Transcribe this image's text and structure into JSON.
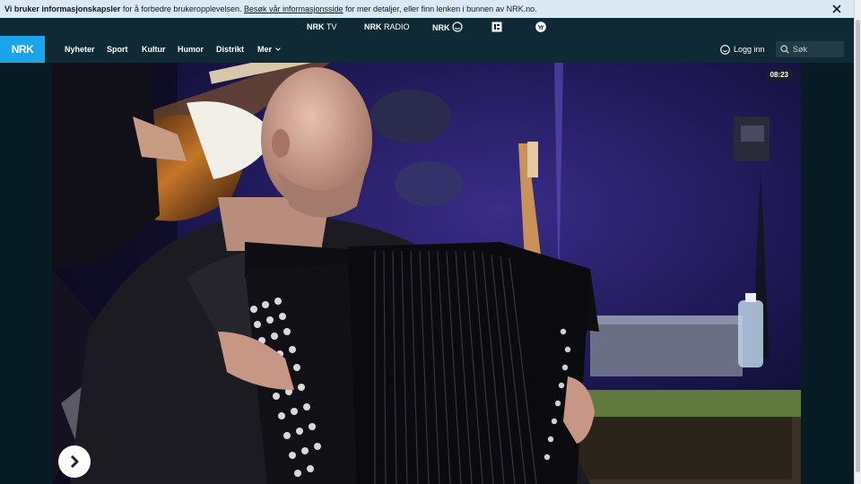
{
  "cookie_banner": {
    "bold_text": "Vi bruker informasjonskapsler",
    "text_after_bold": " for å forbedre brukeropplevelsen. ",
    "link_text": "Besøk vår informasjonsside",
    "text_after_link": " for mer detaljer, eller finn lenken i bunnen av NRK.no.",
    "close_icon": "close-icon"
  },
  "services": {
    "tv_logo": "NRK",
    "tv_label": "TV",
    "radio_logo": "NRK",
    "radio_label": "RADIO",
    "super_logo": "NRK"
  },
  "nav": {
    "logo": "NRK",
    "items": [
      {
        "label": "Nyheter"
      },
      {
        "label": "Sport"
      },
      {
        "label": "Kultur"
      },
      {
        "label": "Humor"
      },
      {
        "label": "Distrikt"
      },
      {
        "label": "Mer"
      }
    ],
    "login_label": "Logg inn",
    "search_placeholder": "Søk"
  },
  "video": {
    "duration": "08:23",
    "play_icon": "play-icon"
  },
  "colors": {
    "accent": "#1aa4ea",
    "nav_bg": "#0f2a35",
    "cookie_bg": "#dbe9f5"
  }
}
